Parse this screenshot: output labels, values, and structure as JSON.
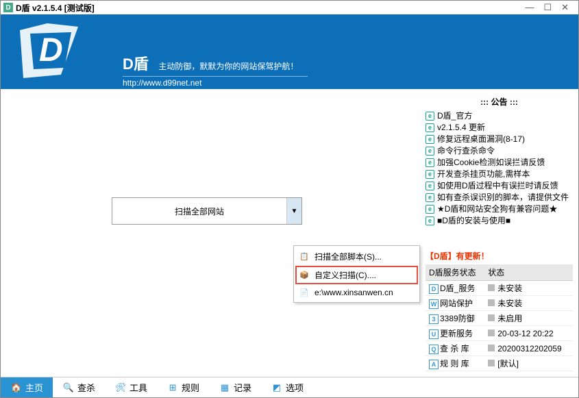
{
  "window": {
    "title": "D盾 v2.1.5.4 [测试版]",
    "min": "—",
    "max": "☐",
    "close": "✕"
  },
  "header": {
    "brand": "D盾",
    "slogan": "主动防御，默默为你的网站保驾护航！",
    "url": "http://www.d99net.net"
  },
  "combo": {
    "text": "扫描全部网站",
    "arrow": "▼"
  },
  "menu": {
    "items": [
      {
        "icon": "📋",
        "label": "扫描全部脚本(S)..."
      },
      {
        "icon": "📦",
        "label": "自定义扫描(C)...."
      },
      {
        "icon": "📄",
        "label": "e:\\www.xinsanwen.cn"
      }
    ]
  },
  "announce": {
    "title": ":::  公告  :::",
    "items": [
      "D盾_官方",
      "v2.1.5.4 更新",
      "修复远程桌面漏洞(8-17)",
      "命令行查杀命令",
      "加强Cookie检测如误拦请反馈",
      "开发查杀挂页功能,需样本",
      "如使用D盾过程中有误拦时请反馈",
      "如有查杀误识别的脚本，请提供文件",
      "★D盾和网站安全狗有兼容问题★",
      "■D盾的安装与使用■"
    ]
  },
  "update": {
    "head": "【D盾】有更新！",
    "col1": "D盾服务状态",
    "col2": "状态",
    "rows": [
      {
        "ic": "D",
        "name": "D盾_服务",
        "state": "未安装"
      },
      {
        "ic": "W",
        "name": "网站保护",
        "state": "未安装"
      },
      {
        "ic": "3",
        "name": "3389防御",
        "state": "未启用"
      },
      {
        "ic": "U",
        "name": "更新服务",
        "state": "20-03-12 20:22"
      },
      {
        "ic": "Q",
        "name": "查 杀 库",
        "state": "20200312202059"
      },
      {
        "ic": "A",
        "name": "规 则 库",
        "state": "[默认]"
      }
    ]
  },
  "tabs": {
    "items": [
      {
        "icon": "🏠",
        "label": "主页"
      },
      {
        "icon": "🔍",
        "label": "查杀"
      },
      {
        "icon": "🛠",
        "label": "工具"
      },
      {
        "icon": "⊞",
        "label": "规则"
      },
      {
        "icon": "▦",
        "label": "记录"
      },
      {
        "icon": "◩",
        "label": "选项"
      }
    ]
  }
}
